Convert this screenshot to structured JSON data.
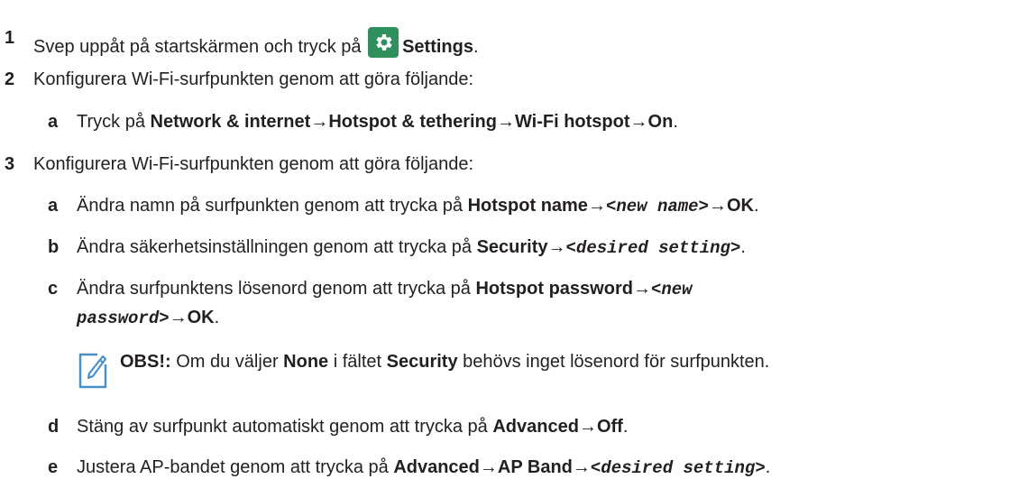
{
  "steps": [
    {
      "num": "1",
      "t1": "Svep uppåt på startskärmen och tryck på ",
      "icon": "settings-gear-icon",
      "b1": "Settings",
      "t2": "."
    },
    {
      "num": "2",
      "t1": "Konfigurera Wi-Fi-surfpunkten genom att göra följande:"
    },
    {
      "sub": "a",
      "t1": "Tryck på ",
      "b1": "Network & internet",
      "a1": "→",
      "b2": "Hotspot & tethering",
      "a2": "→",
      "b3": "Wi-Fi hotspot",
      "a3": "→",
      "b4": "On",
      "t2": "."
    },
    {
      "num": "3",
      "t1": "Konfigurera Wi-Fi-surfpunkten genom att göra följande:"
    },
    {
      "sub": "a",
      "t1": "Ändra namn på surfpunkten genom att trycka på ",
      "b1": "Hotspot name",
      "a1": "→",
      "m1": "<new name>",
      "a2": "→",
      "b2": "OK",
      "t2": "."
    },
    {
      "sub": "b",
      "t1": "Ändra säkerhetsinställningen genom att trycka på ",
      "b1": "Security",
      "a1": "→",
      "m1": "<desired setting>",
      "t2": "."
    },
    {
      "sub": "c",
      "t1": "Ändra surfpunktens lösenord genom att trycka på ",
      "b1": "Hotspot password",
      "a1": "→",
      "m1": "<new",
      "m2": "password>",
      "a2": "→",
      "b2": "OK",
      "t2": "."
    },
    {
      "sub": "d",
      "t1": "Stäng av surfpunkt automatiskt genom att trycka på ",
      "b1": "Advanced",
      "a1": "→",
      "b2": "Off",
      "t2": "."
    },
    {
      "sub": "e",
      "t1": "Justera AP-bandet genom att trycka på ",
      "b1": "Advanced",
      "a1": "→",
      "b2": "AP Band",
      "a2": "→",
      "m1": "<desired setting>",
      "t2": "."
    }
  ],
  "note": {
    "label": "OBS!:",
    "t1": " Om du väljer ",
    "b1": "None",
    "t2": " i fältet ",
    "b2": "Security",
    "t3": " behövs inget lösenord för surfpunkten.",
    "icon": "note-pencil-icon",
    "icon_color": "#4a90c8"
  },
  "colors": {
    "text": "#231f20",
    "settings_icon_bg": "#2f8f5d"
  }
}
